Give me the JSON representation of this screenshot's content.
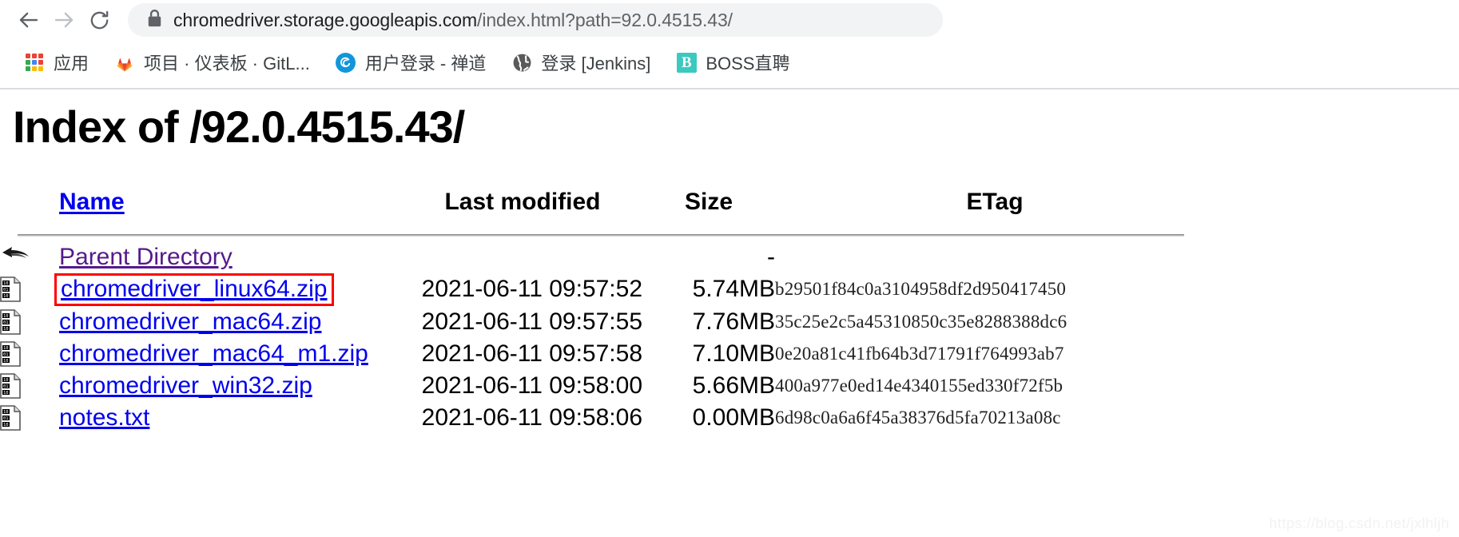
{
  "browser": {
    "back_tooltip": "Back",
    "forward_tooltip": "Forward",
    "reload_tooltip": "Reload",
    "security_icon": "lock-icon",
    "url_secure_part": "chromedriver.storage.googleapis.com",
    "url_path_part": "/index.html?path=92.0.4515.43/",
    "url_full": "chromedriver.storage.googleapis.com/index.html?path=92.0.4515.43/"
  },
  "bookmarks": [
    {
      "label": "应用",
      "icon": "apps-grid-icon"
    },
    {
      "label": "项目 · 仪表板 · GitL...",
      "icon": "gitlab-icon"
    },
    {
      "label": "用户登录 - 禅道",
      "icon": "zentao-icon"
    },
    {
      "label": "登录 [Jenkins]",
      "icon": "jenkins-globe-icon"
    },
    {
      "label": "BOSS直聘",
      "icon": "boss-icon"
    }
  ],
  "page": {
    "title": "Index of /92.0.4515.43/",
    "watermark": "https://blog.csdn.net/jxlhljh"
  },
  "table": {
    "headers": {
      "name": "Name",
      "last_modified": "Last modified",
      "size": "Size",
      "etag": "ETag"
    },
    "rows": [
      {
        "icon": "parent-directory-icon",
        "name": "Parent Directory",
        "last_modified": "",
        "size": "-",
        "etag": "",
        "link_state": "visited",
        "highlighted": false
      },
      {
        "icon": "binary-file-icon",
        "name": "chromedriver_linux64.zip",
        "last_modified": "2021-06-11 09:57:52",
        "size": "5.74MB",
        "etag": "b29501f84c0a3104958df2d950417450",
        "link_state": "unvisited",
        "highlighted": true
      },
      {
        "icon": "binary-file-icon",
        "name": "chromedriver_mac64.zip",
        "last_modified": "2021-06-11 09:57:55",
        "size": "7.76MB",
        "etag": "35c25e2c5a45310850c35e8288388dc6",
        "link_state": "unvisited",
        "highlighted": false
      },
      {
        "icon": "binary-file-icon",
        "name": "chromedriver_mac64_m1.zip",
        "last_modified": "2021-06-11 09:57:58",
        "size": "7.10MB",
        "etag": "0e20a81c41fb64b3d71791f764993ab7",
        "link_state": "unvisited",
        "highlighted": false
      },
      {
        "icon": "binary-file-icon",
        "name": "chromedriver_win32.zip",
        "last_modified": "2021-06-11 09:58:00",
        "size": "5.66MB",
        "etag": "400a977e0ed14e4340155ed330f72f5b",
        "link_state": "unvisited",
        "highlighted": false
      },
      {
        "icon": "binary-file-icon",
        "name": "notes.txt",
        "last_modified": "2021-06-11 09:58:06",
        "size": "0.00MB",
        "etag": "6d98c0a6a6f45a38376d5fa70213a08c",
        "link_state": "unvisited",
        "highlighted": false
      }
    ]
  },
  "colors": {
    "link": "#0000ee",
    "link_visited": "#551a8b",
    "highlight_border": "#ff0000",
    "omnibox_bg": "#f1f3f4",
    "text": "#000000"
  }
}
